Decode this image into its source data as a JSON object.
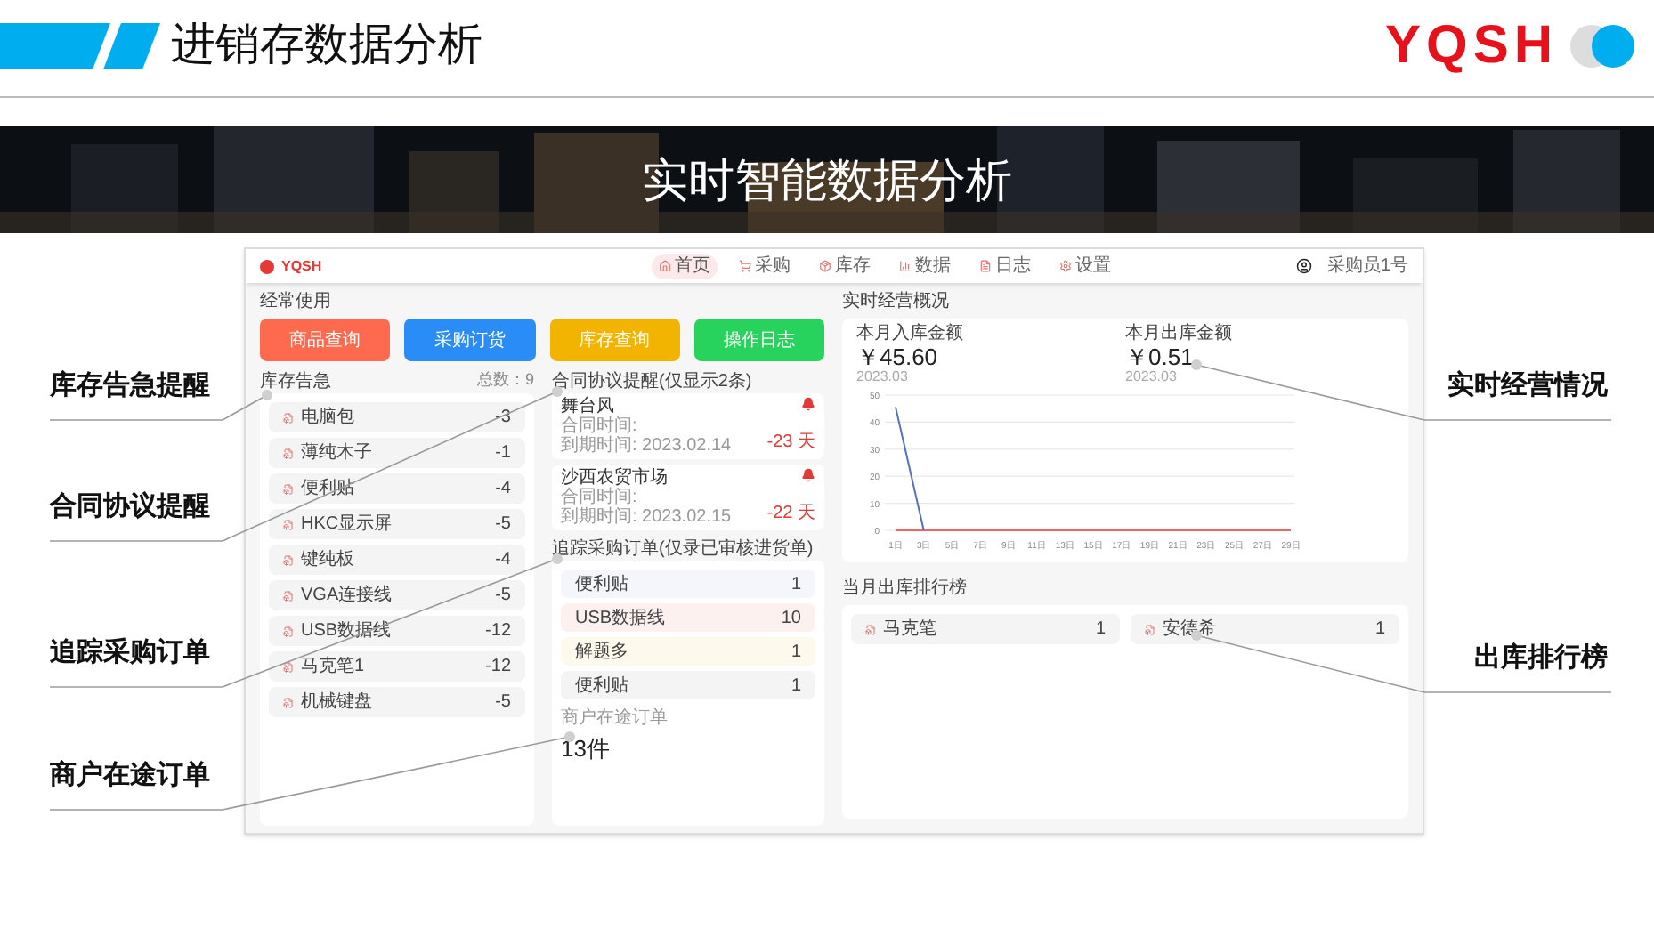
{
  "slide_title": "进销存数据分析",
  "brand": "YQSH",
  "banner": {
    "kind": "picture",
    "title": "实时智能数据分析"
  },
  "callouts_left": [
    "库存告急提醒",
    "合同协议提醒",
    "追踪采购订单",
    "商户在途订单"
  ],
  "callouts_right": [
    "实时经营情况",
    "出库排行榜"
  ],
  "app": {
    "logo": "YQSH",
    "nav": [
      {
        "label": "首页",
        "selected": true
      },
      {
        "label": "采购",
        "selected": false
      },
      {
        "label": "库存",
        "selected": false
      },
      {
        "label": "数据",
        "selected": false
      },
      {
        "label": "日志",
        "selected": false
      },
      {
        "label": "设置",
        "selected": false
      }
    ],
    "user": "采购员1号",
    "shortcuts_title": "经常使用",
    "shortcuts": [
      {
        "label": "商品查询",
        "color": "#fd6a4d"
      },
      {
        "label": "采购订货",
        "color": "#2a8cf7"
      },
      {
        "label": "库存查询",
        "color": "#f2b400"
      },
      {
        "label": "操作日志",
        "color": "#27d35d"
      }
    ],
    "stock_alert": {
      "title": "库存告急",
      "total": "总数：9",
      "items": [
        {
          "name": "电脑包",
          "value": "-3"
        },
        {
          "name": "薄纯木子",
          "value": "-1"
        },
        {
          "name": "便利贴",
          "value": "-4"
        },
        {
          "name": "HKC显示屏",
          "value": "-5"
        },
        {
          "name": "键纯板",
          "value": "-4"
        },
        {
          "name": "VGA连接线",
          "value": "-5"
        },
        {
          "name": "USB数据线",
          "value": "-12"
        },
        {
          "name": "马克笔1",
          "value": "-12"
        },
        {
          "name": "机械键盘",
          "value": "-5"
        }
      ]
    },
    "contracts": {
      "title": "合同协议提醒(仅显示2条)",
      "items": [
        {
          "name": "舞台风",
          "start": "合同时间:",
          "end": "到期时间: 2023.02.14",
          "days": "-23 天"
        },
        {
          "name": "沙西农贸市场",
          "start": "合同时间:",
          "end": "到期时间: 2023.02.15",
          "days": "-22 天"
        }
      ]
    },
    "purchase_orders": {
      "title": "追踪采购订单(仅录已审核进货单)",
      "items": [
        {
          "name": "便利贴",
          "value": "1",
          "color": "#f4f6fc"
        },
        {
          "name": "USB数据线",
          "value": "10",
          "color": "#fdf1f0"
        },
        {
          "name": "解题多",
          "value": "1",
          "color": "#fdf9ec"
        },
        {
          "name": "便利贴",
          "value": "1",
          "color": "#f4f4f4"
        }
      ]
    },
    "transit": {
      "label": "商户在途订单",
      "value": "13件"
    },
    "overview": {
      "title": "实时经营概况",
      "stats": [
        {
          "label": "本月入库金额",
          "value": "￥45.60",
          "date": "2023.03"
        },
        {
          "label": "本月出库金额",
          "value": "￥0.51",
          "date": "2023.03"
        }
      ],
      "chart_data": {
        "type": "line",
        "categories": [
          "1日",
          "3日",
          "5日",
          "7日",
          "9日",
          "11日",
          "13日",
          "15日",
          "17日",
          "19日",
          "21日",
          "23日",
          "25日",
          "27日",
          "29日"
        ],
        "yticks": [
          0,
          10,
          20,
          30,
          40,
          50
        ],
        "ylim": [
          0,
          50
        ],
        "grid": true,
        "series": [
          {
            "color": "#5470c6",
            "values": [
              45.6,
              0,
              null,
              null,
              null,
              null,
              null,
              null,
              null,
              null,
              null,
              null,
              null,
              null,
              null
            ]
          },
          {
            "color": "#ee6666",
            "values": [
              0,
              0,
              0,
              0,
              0,
              0,
              0,
              0,
              0,
              0,
              0,
              0,
              0,
              0,
              0
            ]
          }
        ]
      }
    },
    "ranking": {
      "title": "当月出库排行榜",
      "items": [
        {
          "name": "马克笔",
          "value": "1"
        },
        {
          "name": "安德希",
          "value": "1"
        }
      ]
    }
  }
}
